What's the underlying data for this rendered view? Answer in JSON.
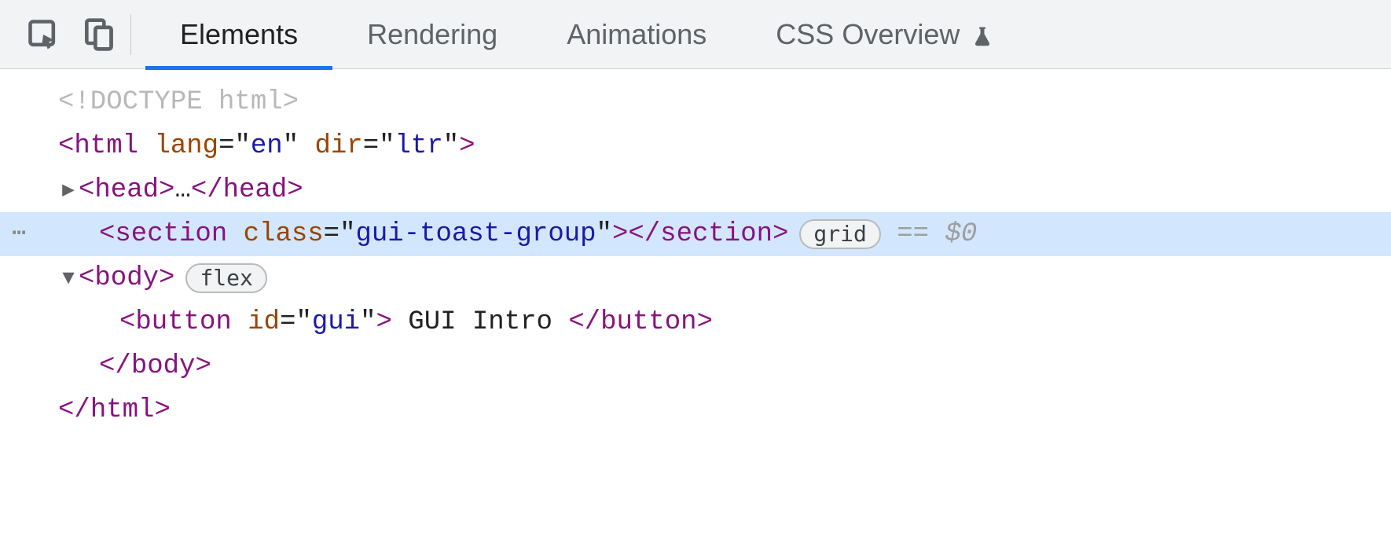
{
  "tabs": {
    "elements": "Elements",
    "rendering": "Rendering",
    "animations": "Animations",
    "css_overview": "CSS Overview"
  },
  "dom": {
    "doctype": "<!DOCTYPE html>",
    "html_open": {
      "tag": "html",
      "attrs": [
        {
          "n": "lang",
          "v": "en"
        },
        {
          "n": "dir",
          "v": "ltr"
        }
      ]
    },
    "head": {
      "tag": "head",
      "ellipsis": "…"
    },
    "section": {
      "tag": "section",
      "attrs": [
        {
          "n": "class",
          "v": "gui-toast-group"
        }
      ],
      "badge": "grid",
      "ref": "$0"
    },
    "body": {
      "tag": "body",
      "badge": "flex"
    },
    "button": {
      "tag": "button",
      "attrs": [
        {
          "n": "id",
          "v": "gui"
        }
      ],
      "text": " GUI Intro "
    },
    "body_close": "body",
    "html_close": "html"
  }
}
